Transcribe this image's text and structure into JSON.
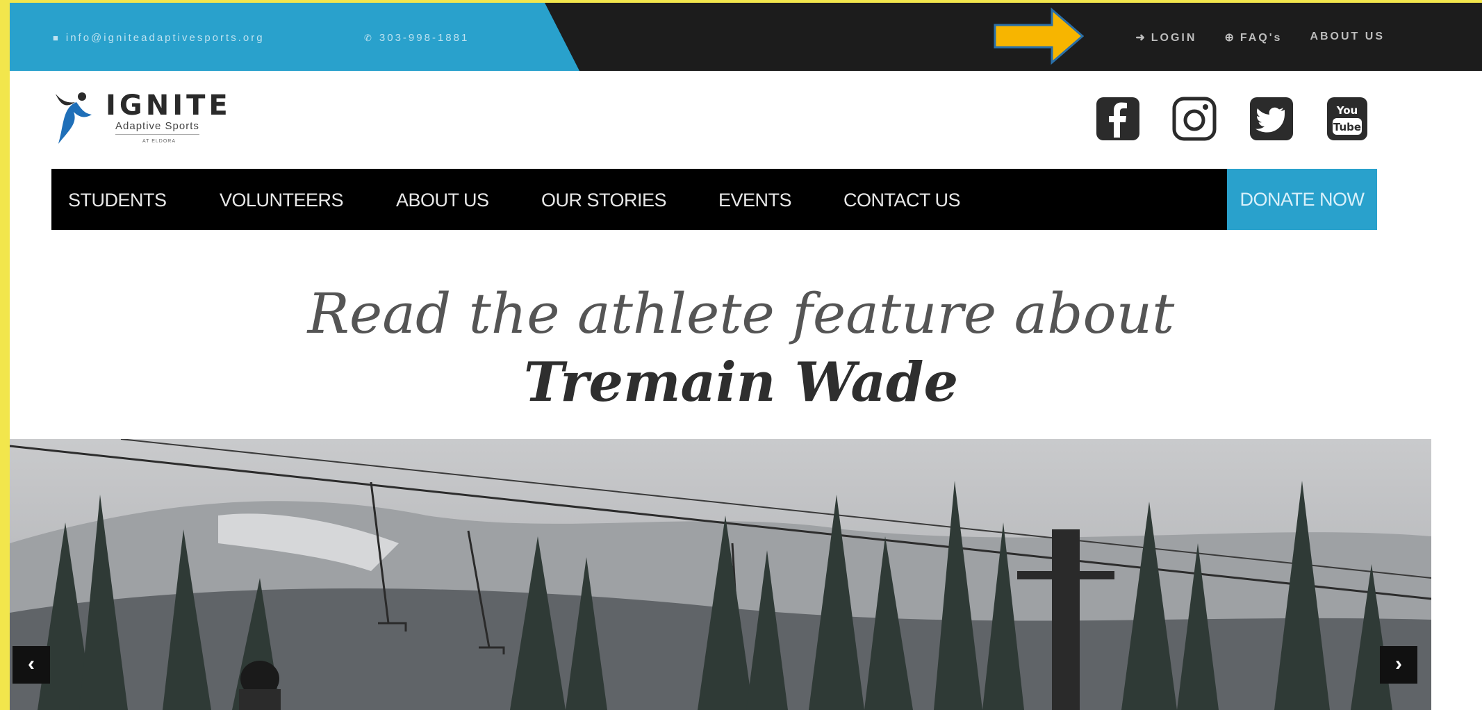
{
  "topbar": {
    "email": "info@igniteadaptivesports.org",
    "phone": "303-998-1881",
    "links": [
      {
        "label": "LOGIN",
        "icon": "login-icon"
      },
      {
        "label": "FAQ's",
        "icon": "question-icon"
      },
      {
        "label": "ABOUT US"
      }
    ]
  },
  "logo": {
    "title": "IGNITE",
    "subtitle": "Adaptive Sports",
    "tagline": "AT ELDORA"
  },
  "social": [
    "facebook-icon",
    "instagram-icon",
    "twitter-icon",
    "youtube-icon"
  ],
  "nav": {
    "items": [
      "STUDENTS",
      "VOLUNTEERS",
      "ABOUT US",
      "OUR STORIES",
      "EVENTS",
      "CONTACT US"
    ],
    "donate": "DONATE NOW"
  },
  "feature": {
    "line1": "Read the athlete feature about",
    "line2": "Tremain Wade"
  },
  "colors": {
    "accent": "#29a1cc",
    "topbar": "#1c1c1c",
    "nav": "#000000",
    "arrow": "#f7b500",
    "frame": "#f2e64c"
  }
}
